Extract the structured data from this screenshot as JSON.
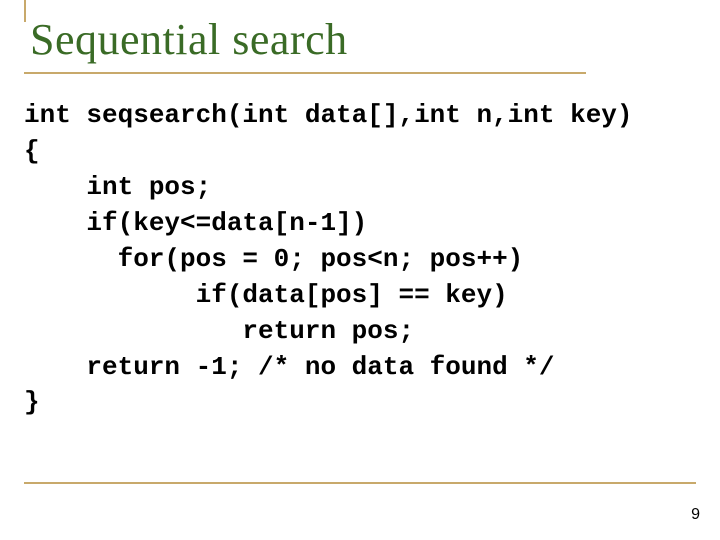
{
  "slide": {
    "title": "Sequential search",
    "code": "int seqsearch(int data[],int n,int key)\n{\n    int pos;\n    if(key<=data[n-1])\n      for(pos = 0; pos<n; pos++)\n           if(data[pos] == key)\n              return pos;\n    return -1; /* no data found */\n}",
    "page_number": "9"
  }
}
